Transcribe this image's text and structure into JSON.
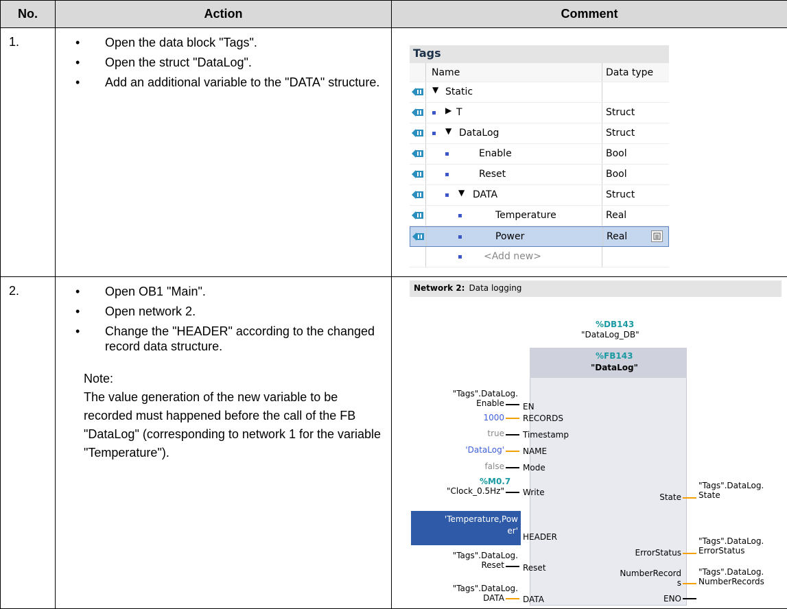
{
  "headers": {
    "no": "No.",
    "action": "Action",
    "comment": "Comment"
  },
  "rows": [
    {
      "no": "1.",
      "bullets": [
        "Open the data block \"Tags\".",
        "Open the struct \"DataLog\".",
        "Add an additional variable to the \"DATA\" structure."
      ]
    },
    {
      "no": "2.",
      "bullets": [
        "Open OB1 \"Main\".",
        "Open network 2.",
        "Change the \"HEADER\" according to the changed record data structure."
      ],
      "note_label": "Note:",
      "note_text": "The value generation of the new variable to be recorded must happened before the call of the FB \"DataLog\" (corresponding to network 1 for the variable \"Temperature\")."
    }
  ],
  "tags_table": {
    "title": "Tags",
    "col_name": "Name",
    "col_type": "Data type",
    "entries": [
      {
        "name": "Static",
        "type": ""
      },
      {
        "name": "T",
        "type": "Struct"
      },
      {
        "name": "DataLog",
        "type": "Struct"
      },
      {
        "name": "Enable",
        "type": "Bool"
      },
      {
        "name": "Reset",
        "type": "Bool"
      },
      {
        "name": "DATA",
        "type": "Struct"
      },
      {
        "name": "Temperature",
        "type": "Real"
      },
      {
        "name": "Power",
        "type": "Real"
      },
      {
        "name": "<Add new>",
        "type": ""
      }
    ]
  },
  "network": {
    "label": "Network 2:",
    "title": "Data logging",
    "db_address": "%DB143",
    "db_name": "\"DataLog_DB\"",
    "fb_address": "%FB143",
    "fb_name": "\"DataLog\"",
    "inputs": {
      "en_tag_1": "\"Tags\".DataLog.",
      "en_tag_2": "Enable",
      "records_val": "1000",
      "timestamp_val": "true",
      "name_val": "'DataLog'",
      "mode_val": "false",
      "write_addr": "%M0.7",
      "write_tag": "\"Clock_0.5Hz\"",
      "header_val_1": "'Temperature,Pow",
      "header_val_2": "er'",
      "reset_tag_1": "\"Tags\".DataLog.",
      "reset_tag_2": "Reset",
      "data_tag_1": "\"Tags\".DataLog.",
      "data_tag_2": "DATA"
    },
    "pins_in": [
      "EN",
      "RECORDS",
      "Timestamp",
      "NAME",
      "Mode",
      "Write",
      "HEADER",
      "Reset",
      "DATA"
    ],
    "pins_out": {
      "state": "State",
      "error": "ErrorStatus",
      "nr_1": "NumberRecord",
      "nr_2": "s",
      "eno": "ENO"
    },
    "outputs": {
      "state_1": "\"Tags\".DataLog.",
      "state_2": "State",
      "error_1": "\"Tags\".DataLog.",
      "error_2": "ErrorStatus",
      "nr_1": "\"Tags\".DataLog.",
      "nr_2": "NumberRecords"
    }
  }
}
